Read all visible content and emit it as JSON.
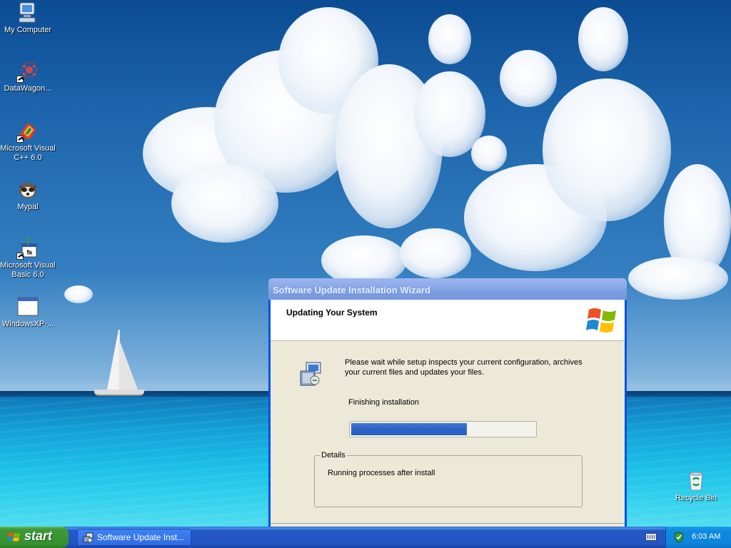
{
  "desktop": {
    "icons": [
      {
        "label": "My Computer",
        "icon": "my-computer-icon"
      },
      {
        "label": "DataWagon...",
        "icon": "datawagon-icon"
      },
      {
        "label": "Microsoft Visual C++ 6.0",
        "icon": "visual-cpp-icon"
      },
      {
        "label": "Mypal",
        "icon": "mypal-icon"
      },
      {
        "label": "Microsoft Visual Basic 6.0",
        "icon": "visual-basic-icon"
      },
      {
        "label": "WindowsXP-...",
        "icon": "application-window-icon"
      },
      {
        "label": "Recycle Bin",
        "icon": "recycle-bin-icon"
      }
    ]
  },
  "wizard": {
    "title": "Software Update Installation Wizard",
    "header": "Updating Your System",
    "info": "Please wait while setup inspects your current configuration, archives your current files and updates your files.",
    "status": "Finishing installation",
    "progress": 0.63,
    "details_label": "Details",
    "details_text": "Running processes after install"
  },
  "taskbar": {
    "start_label": "start",
    "task_button": "Software Update Inst...",
    "clock": "6:03 AM"
  },
  "colors": {
    "progress_fill": "#2c63c5",
    "titlebar": "#7e9ee2",
    "taskbar": "#2356c4",
    "start_button": "#36922f"
  }
}
